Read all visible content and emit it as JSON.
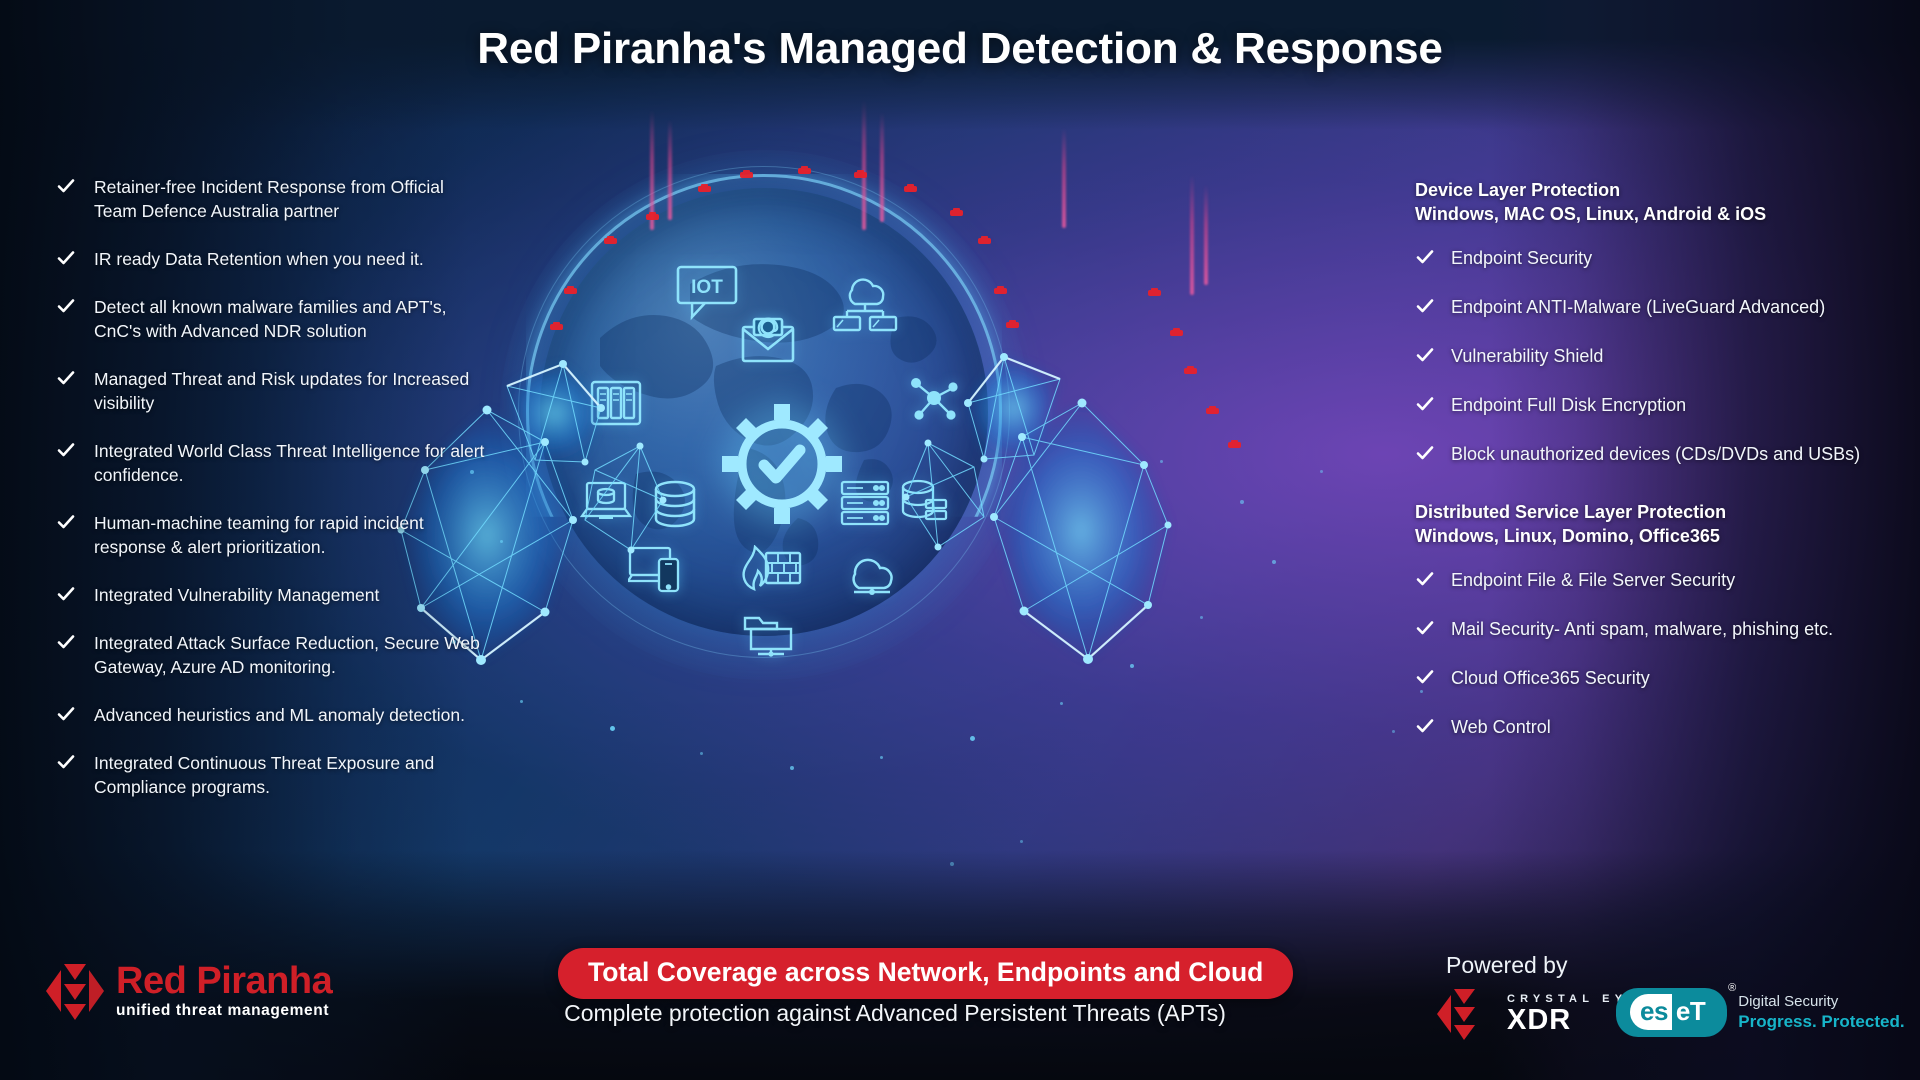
{
  "title": "Red Piranha's Managed Detection & Response",
  "left_features": [
    "Retainer-free Incident Response from Official Team Defence Australia partner",
    "IR ready Data Retention when you need it.",
    "Detect all known malware families and APT's, CnC's with Advanced NDR solution",
    "Managed Threat and Risk updates for Increased visibility",
    "Integrated World Class Threat Intelligence for alert confidence.",
    "Human-machine teaming for rapid incident response & alert prioritization.",
    "Integrated Vulnerability Management",
    "Integrated Attack Surface Reduction, Secure Web Gateway, Azure AD monitoring.",
    "Advanced heuristics and ML anomaly detection.",
    "Integrated Continuous Threat Exposure and Compliance programs."
  ],
  "right_sections": [
    {
      "heading_line1": "Device Layer Protection",
      "heading_line2": "Windows, MAC OS, Linux, Android & iOS",
      "items": [
        "Endpoint Security",
        "Endpoint ANTI-Malware (LiveGuard Advanced)",
        "Vulnerability Shield",
        "Endpoint Full Disk Encryption",
        "Block unauthorized devices (CDs/DVDs and USBs)"
      ]
    },
    {
      "heading_line1": "Distributed Service Layer Protection",
      "heading_line2": "Windows, Linux, Domino, Office365",
      "items": [
        "Endpoint File & File Server Security",
        "Mail Security- Anti spam, malware, phishing etc.",
        "Cloud Office365 Security",
        "Web Control"
      ]
    }
  ],
  "center_graphic": {
    "iot_label": "IOT",
    "icons": [
      "iot-chat-icon",
      "email-icon",
      "cloud-network-icon",
      "nas-storage-icon",
      "molecule-icon",
      "laptop-data-icon",
      "database-icon",
      "gear-check-icon",
      "server-rack-icon",
      "server-stack-icon",
      "laptop-mobile-icon",
      "firewall-icon",
      "cloud-server-icon",
      "shared-folder-icon"
    ]
  },
  "footer": {
    "banner": "Total Coverage across Network, Endpoints and Cloud",
    "subline": "Complete protection against Advanced Persistent Threats (APTs)",
    "powered_by": "Powered by",
    "brand": {
      "name": "Red Piranha",
      "tagline": "unified threat management"
    },
    "crystal_eye": {
      "top": "CRYSTAL EYE",
      "bottom": "XDR"
    },
    "eset": {
      "word_light": "es",
      "word_dark": "eT",
      "registered": "®",
      "tagline_1": "Digital Security",
      "tagline_2": "Progress. Protected."
    }
  },
  "colors": {
    "brand_red": "#cf1f27",
    "banner_red": "#d6202c",
    "eset_teal": "#0c8b9c",
    "accent_cyan": "#8fe3fb"
  }
}
